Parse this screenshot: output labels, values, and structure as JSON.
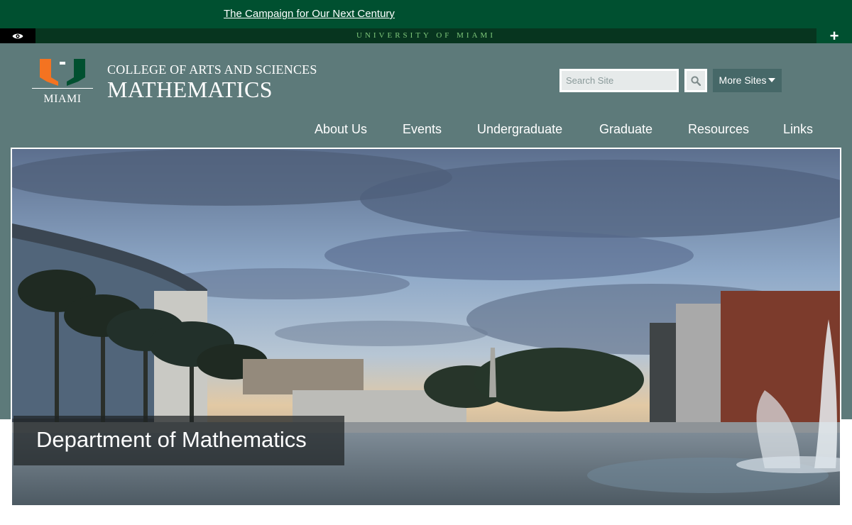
{
  "campaign": {
    "link_text": "The Campaign for Our Next Century"
  },
  "university_bar": {
    "text": "UNIVERSITY OF MIAMI",
    "plus_label": "+"
  },
  "logo": {
    "wordmark": "MIAMI"
  },
  "header": {
    "college": "COLLEGE OF ARTS AND SCIENCES",
    "department": "MATHEMATICS"
  },
  "search": {
    "placeholder": "Search Site",
    "more_sites_label": "More Sites"
  },
  "nav": {
    "items": [
      {
        "label": "About Us"
      },
      {
        "label": "Events"
      },
      {
        "label": "Undergraduate"
      },
      {
        "label": "Graduate"
      },
      {
        "label": "Resources"
      },
      {
        "label": "Links"
      }
    ]
  },
  "hero": {
    "caption": "Department of Mathematics"
  },
  "colors": {
    "brand_green": "#005030",
    "brand_orange": "#f47321",
    "header_bg": "#5d7a7a",
    "univ_text": "#7ec77a"
  },
  "icons": [
    "eye-icon",
    "plus-icon",
    "u-logo",
    "search-icon",
    "caret-down-icon"
  ]
}
